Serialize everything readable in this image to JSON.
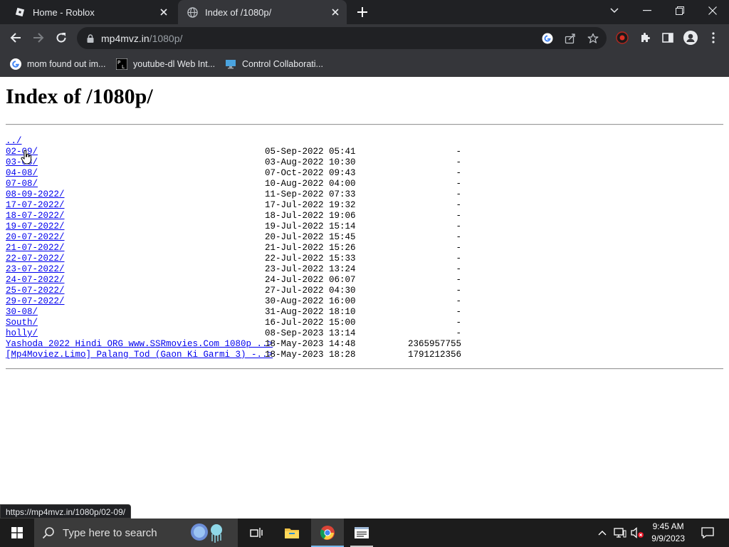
{
  "tabs": [
    {
      "title": "Home - Roblox",
      "favicon": "roblox-icon"
    },
    {
      "title": "Index of /1080p/",
      "favicon": "globe-icon"
    }
  ],
  "address_bar": {
    "host": "mp4mvz.in",
    "path": "/1080p/"
  },
  "bookmarks": [
    {
      "label": "mom found out im...",
      "icon": "google-icon"
    },
    {
      "label": "youtube-dl Web Int...",
      "icon": "pl-icon"
    },
    {
      "label": "Control Collaborati...",
      "icon": "monitor-icon"
    }
  ],
  "page": {
    "heading": "Index of /1080p/",
    "entries": [
      {
        "name": "../",
        "date": "",
        "size": ""
      },
      {
        "name": "02-09/",
        "date": "05-Sep-2022 05:41",
        "size": "-"
      },
      {
        "name": "03-08/",
        "date": "03-Aug-2022 10:30",
        "size": "-"
      },
      {
        "name": "04-08/",
        "date": "07-Oct-2022 09:43",
        "size": "-"
      },
      {
        "name": "07-08/",
        "date": "10-Aug-2022 04:00",
        "size": "-"
      },
      {
        "name": "08-09-2022/",
        "date": "11-Sep-2022 07:33",
        "size": "-"
      },
      {
        "name": "17-07-2022/",
        "date": "17-Jul-2022 19:32",
        "size": "-"
      },
      {
        "name": "18-07-2022/",
        "date": "18-Jul-2022 19:06",
        "size": "-"
      },
      {
        "name": "19-07-2022/",
        "date": "19-Jul-2022 15:14",
        "size": "-"
      },
      {
        "name": "20-07-2022/",
        "date": "20-Jul-2022 15:45",
        "size": "-"
      },
      {
        "name": "21-07-2022/",
        "date": "21-Jul-2022 15:26",
        "size": "-"
      },
      {
        "name": "22-07-2022/",
        "date": "22-Jul-2022 15:33",
        "size": "-"
      },
      {
        "name": "23-07-2022/",
        "date": "23-Jul-2022 13:24",
        "size": "-"
      },
      {
        "name": "24-07-2022/",
        "date": "24-Jul-2022 06:07",
        "size": "-"
      },
      {
        "name": "25-07-2022/",
        "date": "27-Jul-2022 04:30",
        "size": "-"
      },
      {
        "name": "29-07-2022/",
        "date": "30-Aug-2022 16:00",
        "size": "-"
      },
      {
        "name": "30-08/",
        "date": "31-Aug-2022 18:10",
        "size": "-"
      },
      {
        "name": "South/",
        "date": "16-Jul-2022 15:00",
        "size": "-"
      },
      {
        "name": "holly/",
        "date": "08-Sep-2023 13:14",
        "size": "-"
      },
      {
        "name": "Yashoda_2022_Hindi_ORG_www.SSRmovies.Com_1080p_..>",
        "date": "18-May-2023 14:48",
        "size": "2365957755"
      },
      {
        "name": "[Mp4Moviez.Limo]_Palang_Tod_(Gaon_Ki_Garmi_3)_-..>",
        "date": "18-May-2023 18:28",
        "size": "1791212356"
      }
    ]
  },
  "status_url": "https://mp4mvz.in/1080p/02-09/",
  "taskbar": {
    "search_placeholder": "Type here to search",
    "time": "9:45 AM",
    "date": "9/9/2023"
  },
  "colors": {
    "link": "#0000ee",
    "chrome_dark": "#202124",
    "chrome_toolbar": "#35363a"
  }
}
